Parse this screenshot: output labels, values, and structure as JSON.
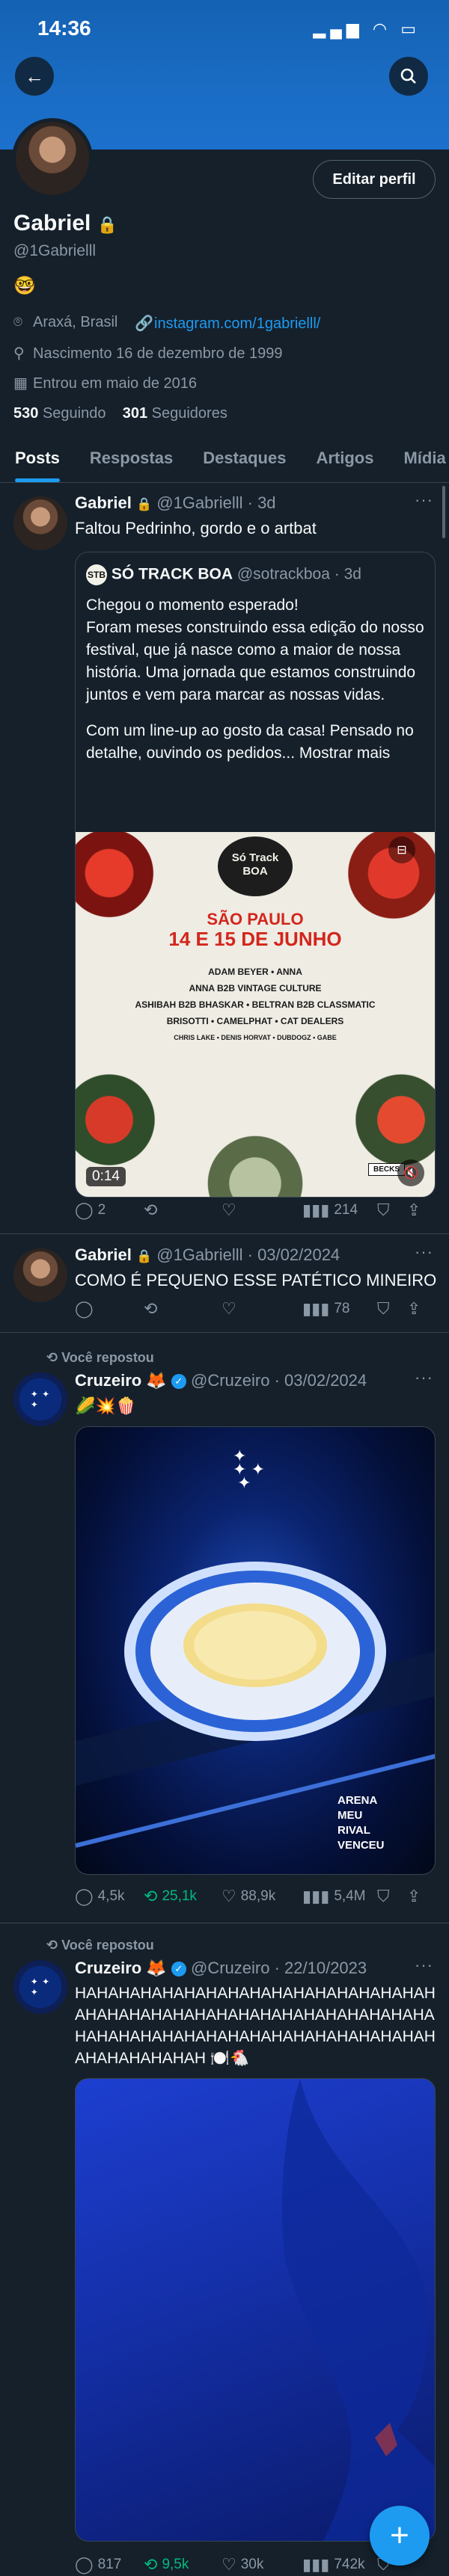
{
  "status_bar": {
    "time": "14:36"
  },
  "profile": {
    "name": "Gabriel",
    "handle": "@1Gabrielll",
    "emoji": "🤓",
    "location": "Araxá, Brasil",
    "website": "instagram.com/1gabrielll/",
    "birth": "Nascimento 16 de dezembro de 1999",
    "joined": "Entrou em maio de 2016",
    "following_count": "530",
    "following_label": "Seguindo",
    "followers_count": "301",
    "followers_label": "Seguidores",
    "edit_label": "Editar perfil"
  },
  "tabs": [
    "Posts",
    "Respostas",
    "Destaques",
    "Artigos",
    "Mídia"
  ],
  "posts": [
    {
      "name": "Gabriel",
      "handle": "@1Gabrielll",
      "sep_time": "· 3d",
      "text": "Faltou Pedrinho, gordo e o artbat",
      "quote": {
        "name": "SÓ TRACK BOA",
        "handle": "@sotrackboa",
        "sep_time": "· 3d",
        "line1": "Chegou o momento esperado!",
        "line2": "Foram meses construindo essa edição do nosso festival, que já nasce como a maior de nossa história. Uma jornada que estamos construindo juntos e vem para marcar as nossas vidas.",
        "line3": "Com um line-up ao gosto da casa! Pensado no detalhe, ouvindo os pedidos...",
        "more": "Mostrar mais",
        "poster": {
          "city": "SÃO PAULO",
          "dates": "14 E 15 DE JUNHO",
          "line_a": "ADAM BEYER • ANNA",
          "line_b": "ANNA B2B VINTAGE CULTURE",
          "line_c": "ASHIBAH B2B BHASKAR • BELTRAN B2B CLASSMATIC",
          "line_d": "BRISOTTI • CAMELPHAT • CAT DEALERS",
          "line_e": "CHRIS LAKE • DENIS HORVAT • DUBDOGZ • GABE",
          "logo": "Só Track BOA",
          "badge": "BECKS"
        },
        "video_time": "0:14"
      },
      "replies": "2",
      "reposts": "",
      "likes": "",
      "views": "214"
    },
    {
      "name": "Gabriel",
      "handle": "@1Gabrielll",
      "sep_time": "· 03/02/2024",
      "text": "COMO É PEQUENO ESSE PATÉTICO MINEIRO",
      "replies": "",
      "reposts": "",
      "likes": "",
      "views": "78"
    },
    {
      "repost_label": "Você repostou",
      "name": "Cruzeiro 🦊",
      "handle": "@Cruzeiro",
      "sep_time": "· 03/02/2024",
      "text": "🌽💥🍿",
      "image_caption": "ARENA\nMEU\nRIVAL\nVENCEU",
      "replies": "4,5k",
      "reposts": "25,1k",
      "likes": "88,9k",
      "views": "5,4M"
    },
    {
      "repost_label": "Você repostou",
      "name": "Cruzeiro 🦊",
      "handle": "@Cruzeiro",
      "sep_time": "· 22/10/2023",
      "text": "HAHAHAHAHAHAHAHAHAHAHAHAHAHAHAHAHAHAHAHAHAHAHAHAHAHAHAHAHAHAHAHAHAHAHAHAHAHAHAHAHAHAHAHAHAHAHAHAHAHAHAHAHAHAHAH 🍽️🐔",
      "replies": "817",
      "reposts": "9,5k",
      "likes": "30k",
      "views": "742k"
    }
  ],
  "colors": {
    "accent": "#1d9bf0",
    "background": "#15202b",
    "muted": "#8b98a5",
    "repost_green": "#00ba7c"
  },
  "icons": [
    "back-arrow-icon",
    "search-icon",
    "lock-icon",
    "location-icon",
    "link-icon",
    "birthday-icon",
    "calendar-icon",
    "more-icon",
    "reply-icon",
    "repost-icon",
    "like-icon",
    "views-icon",
    "bookmark-icon",
    "share-icon",
    "compose-icon"
  ]
}
